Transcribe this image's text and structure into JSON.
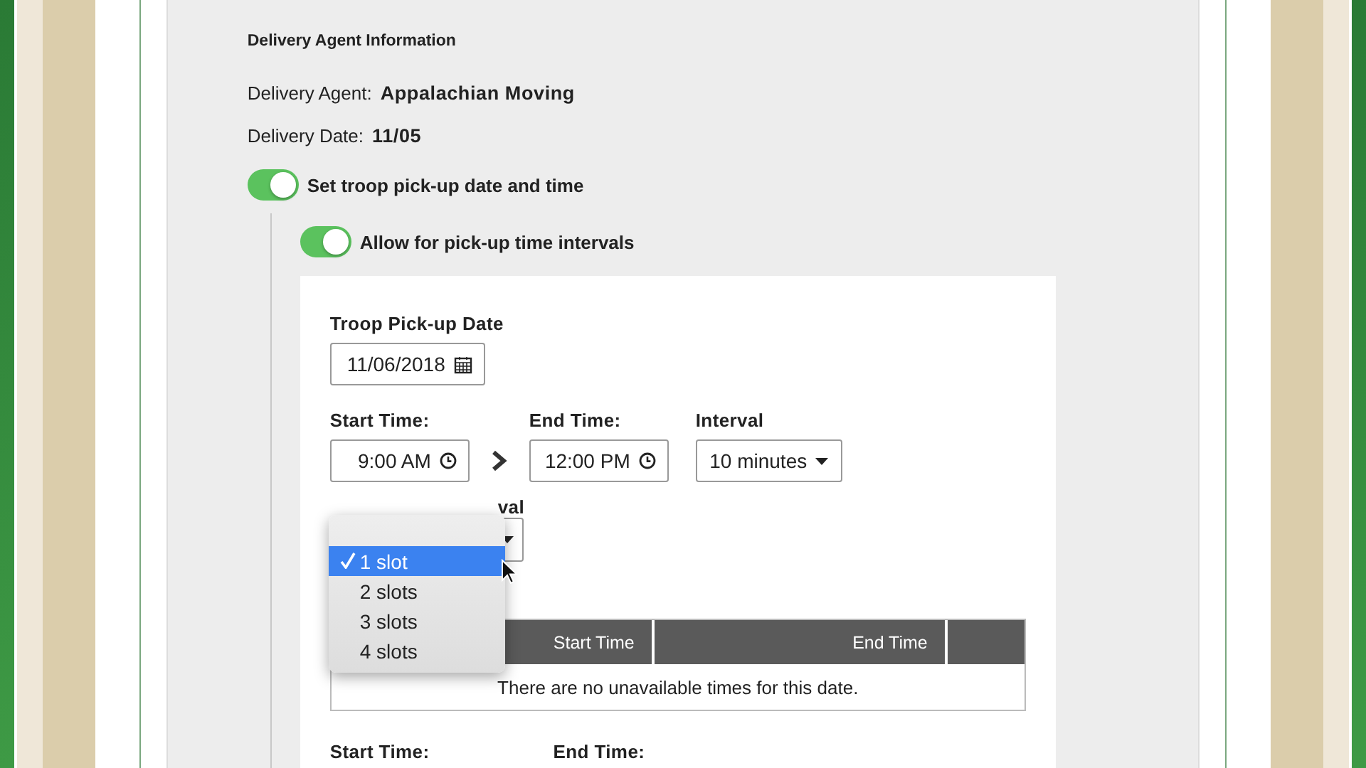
{
  "section_title": "Delivery Agent Information",
  "info": [
    {
      "label": "Delivery Agent:",
      "value": "Appalachian Moving"
    },
    {
      "label": "Delivery Date:",
      "value": "11/05"
    }
  ],
  "toggles": [
    {
      "label": "Set troop pick-up date and time",
      "on": true
    },
    {
      "label": "Allow for pick-up time intervals",
      "on": true
    }
  ],
  "pickup_date": {
    "label": "Troop Pick-up Date",
    "value": "11/06/2018"
  },
  "start_time": {
    "label": "Start Time:",
    "value": "9:00 AM"
  },
  "end_time": {
    "label": "End Time:",
    "value": "12:00 PM"
  },
  "interval": {
    "label": "Interval",
    "value": "10 minutes"
  },
  "slots": {
    "label": "val",
    "menu": [
      {
        "label": "1 slot",
        "selected": true
      },
      {
        "label": "2 slots",
        "selected": false
      },
      {
        "label": "3 slots",
        "selected": false
      },
      {
        "label": "4 slots",
        "selected": false
      }
    ]
  },
  "table": {
    "columns": [
      "Start Time",
      "End Time"
    ],
    "empty_message": "There are no unavailable times for this date."
  },
  "next_row": {
    "start_label": "Start Time:",
    "end_label": "End Time:"
  }
}
